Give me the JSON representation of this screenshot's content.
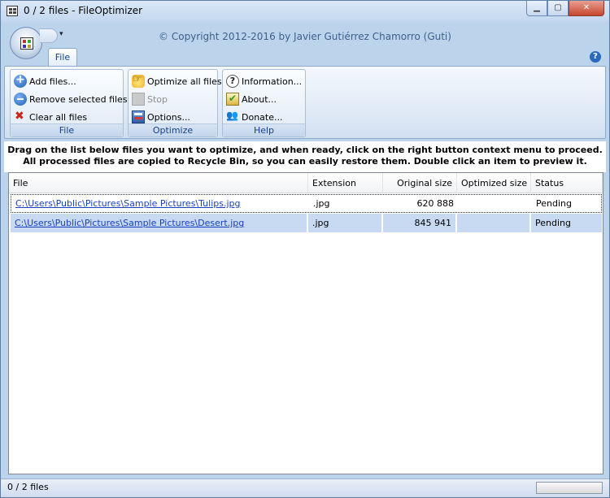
{
  "window": {
    "title": "0 / 2 files - FileOptimizer",
    "minimize_glyph": "▁",
    "maximize_glyph": "▢",
    "close_glyph": "✕"
  },
  "header": {
    "copyright": "© Copyright 2012-2016 by Javier Gutiérrez Chamorro (Guti)",
    "qat_arrow": "▾",
    "help_glyph": "?"
  },
  "tabs": [
    {
      "label": "File",
      "active": true
    }
  ],
  "ribbon": {
    "groups": [
      {
        "label": "File",
        "buttons": [
          {
            "label": "Add files...",
            "icon": "add-icon"
          },
          {
            "label": "Remove selected files",
            "icon": "remove-icon"
          },
          {
            "label": "Clear all files",
            "icon": "clear-icon"
          }
        ]
      },
      {
        "label": "Optimize",
        "buttons": [
          {
            "label": "Optimize all files",
            "icon": "optimize-icon"
          },
          {
            "label": "Stop",
            "icon": "stop-icon",
            "disabled": true
          },
          {
            "label": "Options...",
            "icon": "options-icon"
          }
        ]
      },
      {
        "label": "Help",
        "buttons": [
          {
            "label": "Information...",
            "icon": "information-icon"
          },
          {
            "label": "About...",
            "icon": "about-icon"
          },
          {
            "label": "Donate...",
            "icon": "donate-icon"
          }
        ]
      }
    ]
  },
  "instructions": "Drag on the list below files you want to optimize, and when ready, click on the right button context menu to proceed. All processed files are copied to Recycle Bin, so you can easily restore them. Double click an item to preview it.",
  "list": {
    "columns": [
      "File",
      "Extension",
      "Original size",
      "Optimized size",
      "Status"
    ],
    "rows": [
      {
        "file": "C:\\Users\\Public\\Pictures\\Sample Pictures\\Tulips.jpg",
        "extension": ".jpg",
        "original_size": "620 888",
        "optimized_size": "",
        "status": "Pending"
      },
      {
        "file": "C:\\Users\\Public\\Pictures\\Sample Pictures\\Desert.jpg",
        "extension": ".jpg",
        "original_size": "845 941",
        "optimized_size": "",
        "status": "Pending"
      }
    ]
  },
  "statusbar": {
    "text": "0 / 2 files"
  },
  "colors": {
    "link": "#1a3fbf",
    "ribbon_label": "#15428b",
    "selection": "#c7daf2"
  }
}
